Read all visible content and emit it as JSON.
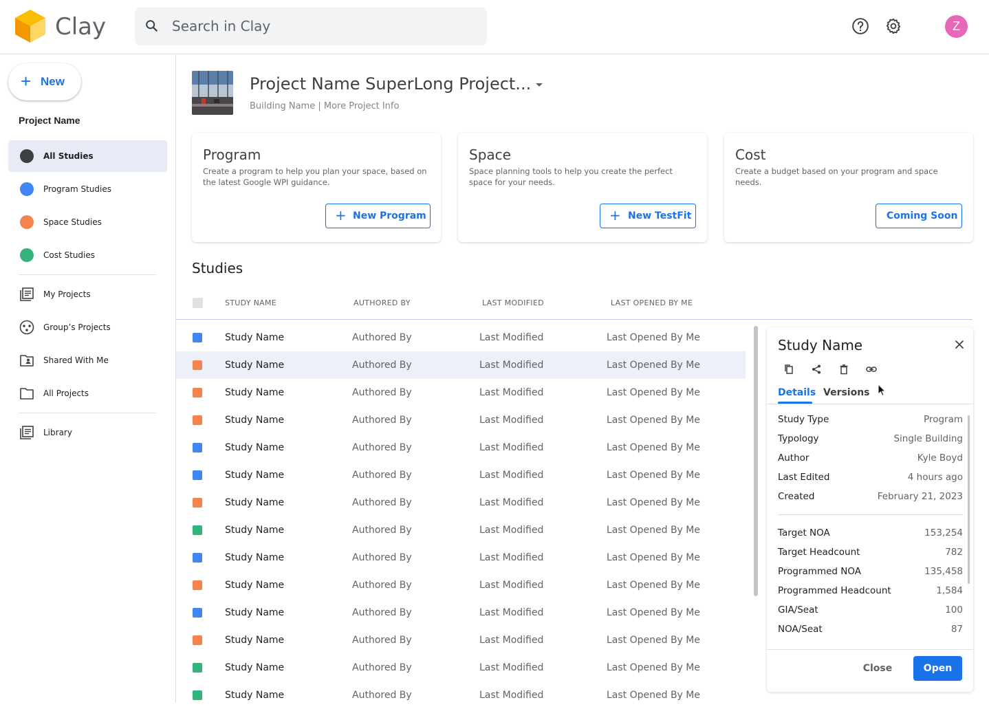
{
  "app": {
    "title": "Clay"
  },
  "search": {
    "placeholder": "Search in Clay"
  },
  "user": {
    "initial": "Z",
    "avatar_color": "#e767b8"
  },
  "sidebar": {
    "new_label": "New",
    "project_label": "Project Name",
    "studies": [
      {
        "label": "All Studies",
        "color": "#3c4043",
        "active": true
      },
      {
        "label": "Program Studies",
        "color": "#4285f4"
      },
      {
        "label": "Space Studies",
        "color": "#f4844c"
      },
      {
        "label": "Cost Studies",
        "color": "#34b37a"
      }
    ],
    "projects": [
      {
        "label": "My Projects",
        "icon": "list-icon"
      },
      {
        "label": "Group’s Projects",
        "icon": "group-icon"
      },
      {
        "label": "Shared With Me",
        "icon": "shared-folder-icon"
      },
      {
        "label": "All Projects",
        "icon": "folder-icon"
      }
    ],
    "library": {
      "label": "Library",
      "icon": "library-icon"
    }
  },
  "project": {
    "title": "Project Name SuperLong Project...",
    "subtitle": "Building Name | More Project Info"
  },
  "cards": [
    {
      "title": "Program",
      "description": "Create a program to help you plan your space, based on the latest Google WPI guidance.",
      "button": "New Program",
      "has_plus": true
    },
    {
      "title": "Space",
      "description": "Space planning tools to help you create the perfect space for your needs.",
      "button": "New TestFit",
      "has_plus": true
    },
    {
      "title": "Cost",
      "description": "Create a budget based on your program and space needs.",
      "button": "Coming Soon",
      "has_plus": false
    }
  ],
  "studies": {
    "heading": "Studies",
    "columns": [
      "STUDY NAME",
      "AUTHORED BY",
      "LAST MODIFIED",
      "LAST OPENED BY ME"
    ],
    "rows": [
      {
        "color": "#4285f4",
        "name": "Study Name",
        "author": "Authored By",
        "modified": "Last Modified",
        "opened": "Last Opened By Me"
      },
      {
        "color": "#f4844c",
        "name": "Study Name",
        "author": "Authored By",
        "modified": "Last Modified",
        "opened": "Last Opened By Me",
        "highlighted": true
      },
      {
        "color": "#f4844c",
        "name": "Study Name",
        "author": "Authored By",
        "modified": "Last Modified",
        "opened": "Last Opened By Me"
      },
      {
        "color": "#f4844c",
        "name": "Study Name",
        "author": "Authored By",
        "modified": "Last Modified",
        "opened": "Last Opened By Me"
      },
      {
        "color": "#4285f4",
        "name": "Study Name",
        "author": "Authored By",
        "modified": "Last Modified",
        "opened": "Last Opened By Me"
      },
      {
        "color": "#4285f4",
        "name": "Study Name",
        "author": "Authored By",
        "modified": "Last Modified",
        "opened": "Last Opened By Me"
      },
      {
        "color": "#f4844c",
        "name": "Study Name",
        "author": "Authored By",
        "modified": "Last Modified",
        "opened": "Last Opened By Me"
      },
      {
        "color": "#34b37a",
        "name": "Study Name",
        "author": "Authored By",
        "modified": "Last Modified",
        "opened": "Last Opened By Me"
      },
      {
        "color": "#4285f4",
        "name": "Study Name",
        "author": "Authored By",
        "modified": "Last Modified",
        "opened": "Last Opened By Me"
      },
      {
        "color": "#f4844c",
        "name": "Study Name",
        "author": "Authored By",
        "modified": "Last Modified",
        "opened": "Last Opened By Me"
      },
      {
        "color": "#4285f4",
        "name": "Study Name",
        "author": "Authored By",
        "modified": "Last Modified",
        "opened": "Last Opened By Me"
      },
      {
        "color": "#f4844c",
        "name": "Study Name",
        "author": "Authored By",
        "modified": "Last Modified",
        "opened": "Last Opened By Me"
      },
      {
        "color": "#34b37a",
        "name": "Study Name",
        "author": "Authored By",
        "modified": "Last Modified",
        "opened": "Last Opened By Me"
      },
      {
        "color": "#34b37a",
        "name": "Study Name",
        "author": "Authored By",
        "modified": "Last Modified",
        "opened": "Last Opened By Me"
      }
    ]
  },
  "detail": {
    "title": "Study Name",
    "tabs": [
      "Details",
      "Versions"
    ],
    "info": [
      {
        "k": "Study Type",
        "v": "Program"
      },
      {
        "k": "Typology",
        "v": "Single Building"
      },
      {
        "k": "Author",
        "v": "Kyle Boyd"
      },
      {
        "k": "Last Edited",
        "v": "4 hours ago"
      },
      {
        "k": "Created",
        "v": "February 21, 2023"
      }
    ],
    "metrics": [
      {
        "k": "Target NOA",
        "v": "153,254"
      },
      {
        "k": "Target Headcount",
        "v": "782"
      },
      {
        "k": "Programmed NOA",
        "v": "135,458"
      },
      {
        "k": "Programmed Headcount",
        "v": "1,584"
      },
      {
        "k": "GIA/Seat",
        "v": "100"
      },
      {
        "k": "NOA/Seat",
        "v": "87"
      }
    ],
    "close_label": "Close",
    "open_label": "Open"
  }
}
